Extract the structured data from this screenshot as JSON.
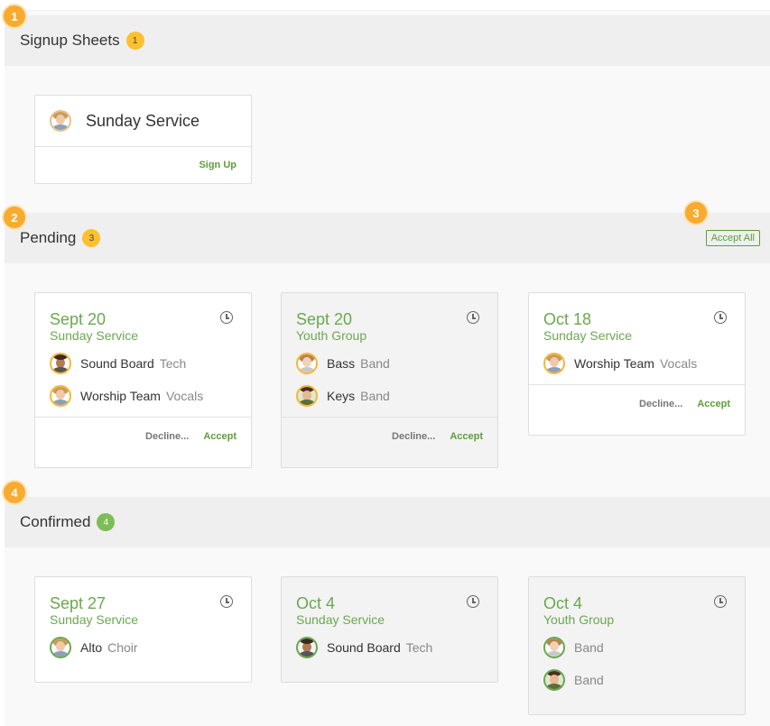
{
  "sections": {
    "signup": {
      "title": "Signup Sheets",
      "count": "1",
      "marker": "1"
    },
    "pending": {
      "title": "Pending",
      "count": "3",
      "marker": "2",
      "accept_all_label": "Accept All",
      "accept_all_marker": "3"
    },
    "confirmed": {
      "title": "Confirmed",
      "count": "4",
      "marker": "4"
    }
  },
  "signup_card": {
    "name": "Sunday Service",
    "action": "Sign Up"
  },
  "pending_cards": [
    {
      "date": "Sept 20",
      "event": "Sunday Service",
      "roles": [
        {
          "position": "Sound Board",
          "team": "Tech"
        },
        {
          "position": "Worship Team",
          "team": "Vocals"
        }
      ],
      "decline": "Decline...",
      "accept": "Accept"
    },
    {
      "date": "Sept 20",
      "event": "Youth Group",
      "roles": [
        {
          "position": "Bass",
          "team": "Band"
        },
        {
          "position": "Keys",
          "team": "Band"
        }
      ],
      "decline": "Decline...",
      "accept": "Accept"
    },
    {
      "date": "Oct 18",
      "event": "Sunday Service",
      "roles": [
        {
          "position": "Worship Team",
          "team": "Vocals"
        }
      ],
      "decline": "Decline...",
      "accept": "Accept"
    }
  ],
  "confirmed_cards": [
    {
      "date": "Sept 27",
      "event": "Sunday Service",
      "roles": [
        {
          "position": "Alto",
          "team": "Choir"
        }
      ]
    },
    {
      "date": "Oct 4",
      "event": "Sunday Service",
      "roles": [
        {
          "position": "Sound Board",
          "team": "Tech"
        }
      ]
    },
    {
      "date": "Oct 4",
      "event": "Youth Group",
      "roles": [
        {
          "position": "",
          "team": "Band"
        },
        {
          "position": "",
          "team": "Band"
        }
      ]
    }
  ],
  "colors": {
    "accent_green": "#6aa84f",
    "badge_yellow": "#fdc02e",
    "marker_orange": "#f8ab2e"
  },
  "icons": {
    "clock": "clock-icon",
    "avatar": "avatar-icon"
  }
}
